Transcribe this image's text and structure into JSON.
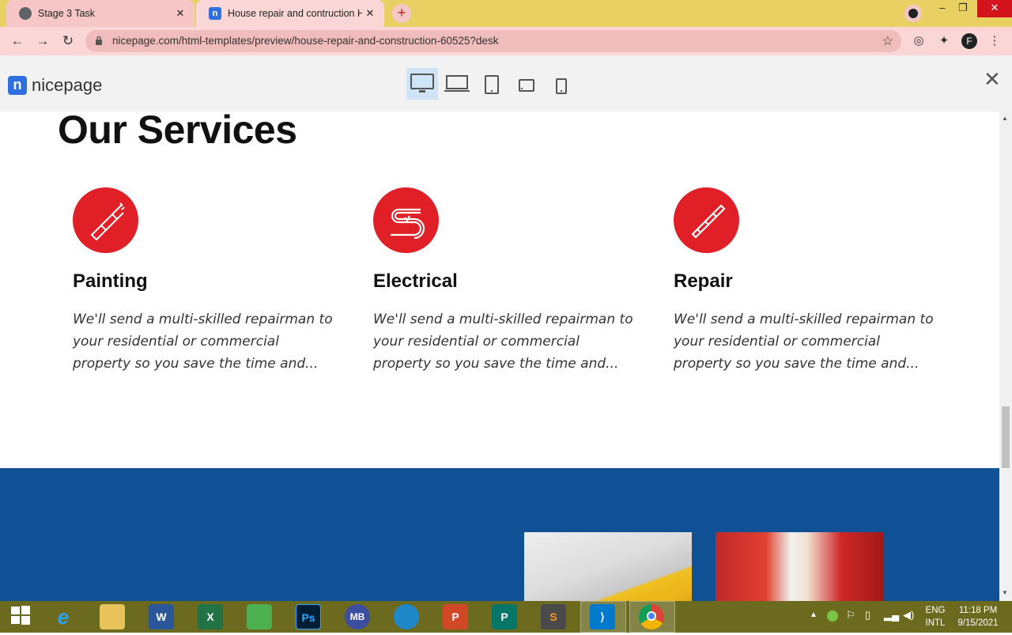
{
  "browser": {
    "tabs": [
      {
        "title": "Stage 3 Task",
        "active": false
      },
      {
        "title": "House repair and contruction HTML",
        "active": true
      }
    ],
    "new_tab_label": "+",
    "url": "nicepage.com/html-templates/preview/house-repair-and-construction-60525?desk",
    "window_controls": {
      "minimize": "‒",
      "restore": "❐",
      "close": "✕"
    }
  },
  "preview_bar": {
    "logo_text": "nicepage",
    "devices": [
      "desktop-icon",
      "laptop-icon",
      "tablet-icon",
      "tablet-landscape-icon",
      "phone-icon"
    ],
    "selected_device": "desktop",
    "close_label": "✕"
  },
  "page": {
    "section_title": "Our Services",
    "services": [
      {
        "icon": "paint-brush-icon",
        "title": "Painting",
        "text": "We'll send a multi-skilled repairman to your residential or commercial property so you save the time and..."
      },
      {
        "icon": "electrical-wire-icon",
        "title": "Electrical",
        "text": "We'll send a multi-skilled repairman to your residential or commercial property so you save the time and..."
      },
      {
        "icon": "screwdriver-icon",
        "title": "Repair",
        "text": "We'll send a multi-skilled repairman to your residential or commercial property so you save the time and..."
      }
    ],
    "accent_color": "#e01f26",
    "band_color": "#0f5194"
  },
  "taskbar": {
    "apps": [
      "windows-start-icon",
      "internet-explorer-icon",
      "file-explorer-icon",
      "word-icon",
      "excel-icon",
      "sketch-app-icon",
      "photoshop-icon",
      "mb-app-icon",
      "edge-icon",
      "powerpoint-icon",
      "publisher-icon",
      "sublime-text-icon",
      "vscode-icon",
      "chrome-icon"
    ],
    "word_label": "W",
    "excel_label": "X",
    "ps_label": "Ps",
    "mb_label": "MB",
    "ppt_label": "P",
    "pub_label": "P",
    "sublime_label": "S",
    "lang_1": "ENG",
    "lang_2": "INTL",
    "time": "11:18 PM",
    "date": "9/15/2021"
  }
}
